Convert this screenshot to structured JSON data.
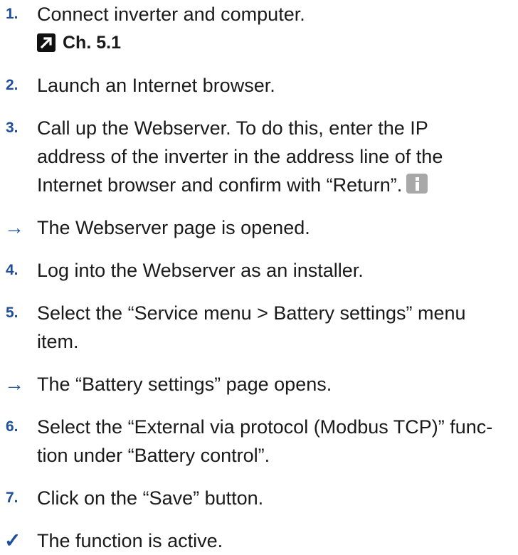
{
  "steps": [
    {
      "marker": "1.",
      "lines": [
        "Connect inverter and computer."
      ],
      "ref": "Ch. 5.1"
    },
    {
      "marker": "2.",
      "lines": [
        "Launch an Internet browser."
      ]
    },
    {
      "marker": "3.",
      "lines": [
        "Call up the Webserver. To do this, enter the IP",
        "address of the inverter in the address line of the",
        "Internet browser and confirm with “Return”."
      ]
    },
    {
      "marker": "→",
      "lines": [
        "The Webserver page is opened."
      ]
    },
    {
      "marker": "4.",
      "lines": [
        "Log into the Webserver as an installer."
      ]
    },
    {
      "marker": "5.",
      "lines": [
        "Select the “Service menu > Battery settings” menu",
        "item."
      ]
    },
    {
      "marker": "→",
      "lines": [
        "The “Battery settings” page opens."
      ]
    },
    {
      "marker": "6.",
      "lines": [
        "Select the “External via protocol (Modbus TCP)” func-",
        "tion under “Battery control”."
      ]
    },
    {
      "marker": "7.",
      "lines": [
        "Click on the “Save” button."
      ]
    },
    {
      "marker": "✓",
      "lines": [
        "The function is active."
      ]
    }
  ]
}
